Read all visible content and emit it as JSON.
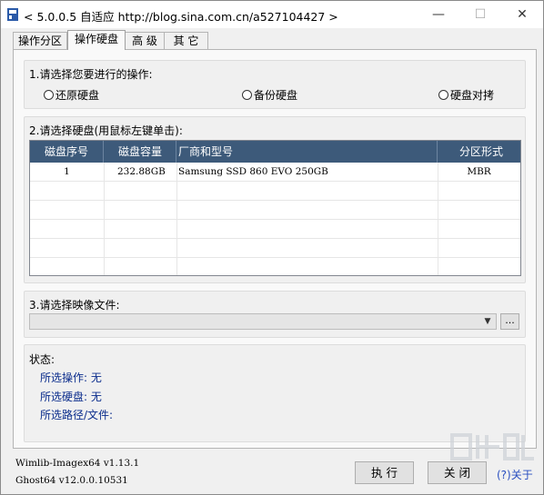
{
  "window": {
    "title": "< 5.0.0.5 自适应 http://blog.sina.com.cn/a527104427 >",
    "min_label": "—",
    "max_label": "☐",
    "close_label": "✕"
  },
  "tabs": [
    {
      "label": "操作分区"
    },
    {
      "label": "操作硬盘"
    },
    {
      "label": "高 级"
    },
    {
      "label": "其 它"
    }
  ],
  "operation": {
    "label": "1.请选择您要进行的操作:",
    "options": [
      "还原硬盘",
      "备份硬盘",
      "硬盘对拷"
    ]
  },
  "disk": {
    "label": "2.请选择硬盘(用鼠标左键单击):",
    "columns": [
      "磁盘序号",
      "磁盘容量",
      "厂商和型号",
      "分区形式"
    ],
    "rows": [
      {
        "index": "1",
        "capacity": "232.88GB",
        "model": "Samsung SSD 860 EVO 250GB",
        "partition": "MBR"
      }
    ]
  },
  "image": {
    "label": "3.请选择映像文件:",
    "value": "",
    "browse_label": "..."
  },
  "status": {
    "title": "状态:",
    "operation": "所选操作: 无",
    "disk": "所选硬盘: 无",
    "path": "所选路径/文件:"
  },
  "footer": {
    "wimlib": "Wimlib-Imagex64 v1.13.1",
    "ghost": "Ghost64 v12.0.0.10531",
    "execute_label": "执 行",
    "close_label": "关 闭",
    "about_label": "(?)关于"
  },
  "colors": {
    "header_bg": "#3d5a7a",
    "status_text": "#0a2c8c"
  },
  "icons": {
    "app": "app-logo-icon",
    "combo": "chevron-down-icon"
  }
}
